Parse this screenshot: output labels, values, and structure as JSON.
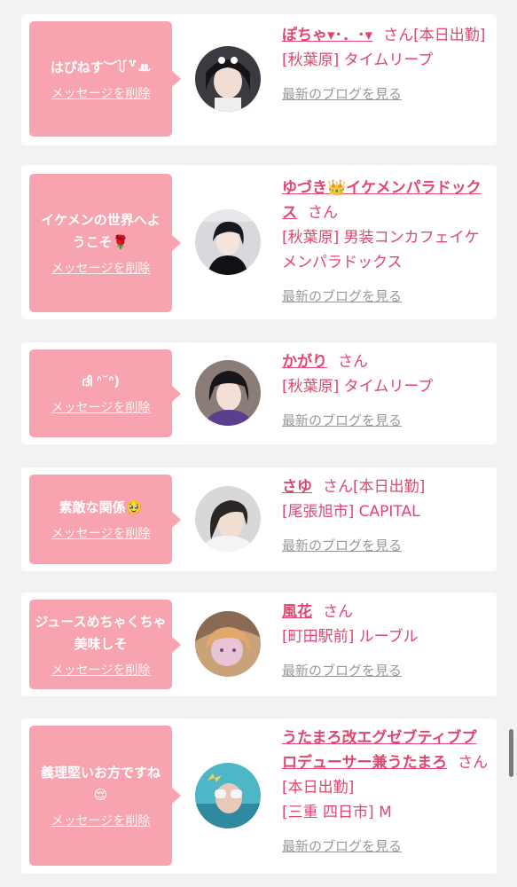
{
  "colors": {
    "accent_pink": "#e0466f",
    "bubble_pink": "#f7a3b0",
    "link_gray": "#999999",
    "background": "#f2f2f2"
  },
  "cards": [
    {
      "message": "はぴねす︶꒦꒷ꔚ",
      "delete_label": "メッセージを削除",
      "name": "ぽちゃ▾･．･▾",
      "honorific": "さん",
      "status": "[本日出勤]",
      "location": "[秋葉原] タイムリープ",
      "blog_label": "最新のブログを見る",
      "avatar_icon": "profile-photo"
    },
    {
      "message": "イケメンの世界へようこそ🌹",
      "delete_label": "メッセージを削除",
      "name": "ゆづき👑イケメンパラドックス",
      "honorific": "さん",
      "status": "",
      "location": "[秋葉原] 男装コンカフェイケメンパラドックス",
      "blog_label": "最新のブログを見る",
      "avatar_icon": "profile-photo"
    },
    {
      "message": "ദി ᐢ˘ᐢ)",
      "delete_label": "メッセージを削除",
      "name": "かがり",
      "honorific": "さん",
      "status": "",
      "location": "[秋葉原] タイムリープ",
      "blog_label": "最新のブログを見る",
      "avatar_icon": "profile-photo"
    },
    {
      "message": "素敵な関係🥹",
      "delete_label": "メッセージを削除",
      "name": "さゆ",
      "honorific": "さん",
      "status": "[本日出勤]",
      "location": "[尾張旭市] CAPITAL",
      "blog_label": "最新のブログを見る",
      "avatar_icon": "profile-photo"
    },
    {
      "message": "ジュースめちゃくちゃ美味しそ",
      "delete_label": "メッセージを削除",
      "name": "風花",
      "honorific": "さん",
      "status": "",
      "location": "[町田駅前] ルーブル",
      "blog_label": "最新のブログを見る",
      "avatar_icon": "profile-photo"
    },
    {
      "message": "義理堅いお方ですね😌",
      "delete_label": "メッセージを削除",
      "name": "うたまろ改エグゼブティブプロデューサー兼うたまろ",
      "honorific": "さん",
      "status": "[本日出勤]",
      "location": "[三重 四日市] M",
      "blog_label": "最新のブログを見る",
      "avatar_icon": "profile-photo"
    }
  ]
}
